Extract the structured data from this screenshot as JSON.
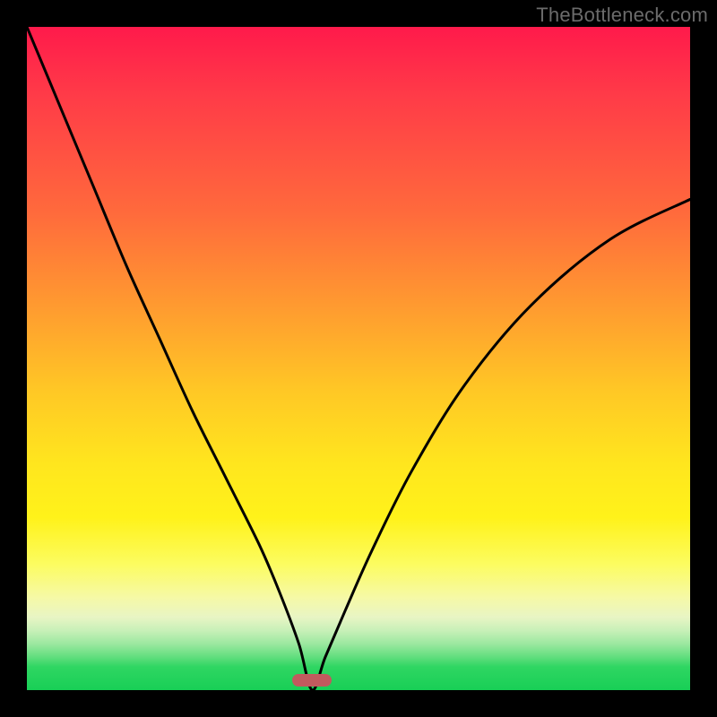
{
  "watermark": "TheBottleneck.com",
  "colors": {
    "background": "#000000",
    "gradient_top": "#ff1a4b",
    "gradient_bottom": "#18cf56",
    "curve": "#000000",
    "marker": "#c15a5e"
  },
  "chart_data": {
    "type": "line",
    "title": "",
    "xlabel": "",
    "ylabel": "",
    "xlim": [
      0,
      100
    ],
    "ylim": [
      0,
      100
    ],
    "background": "rainbow-vertical-gradient",
    "minimum_x": 43,
    "marker": {
      "x_center": 43,
      "width_pct": 6
    },
    "series": [
      {
        "name": "bottleneck-curve",
        "x": [
          0,
          5,
          10,
          15,
          20,
          25,
          30,
          35,
          38,
          41,
          43,
          45,
          48,
          52,
          58,
          66,
          76,
          88,
          100
        ],
        "values": [
          100,
          88,
          76,
          64,
          53,
          42,
          32,
          22,
          15,
          7,
          0,
          5,
          12,
          21,
          33,
          46,
          58,
          68,
          74
        ]
      }
    ]
  }
}
